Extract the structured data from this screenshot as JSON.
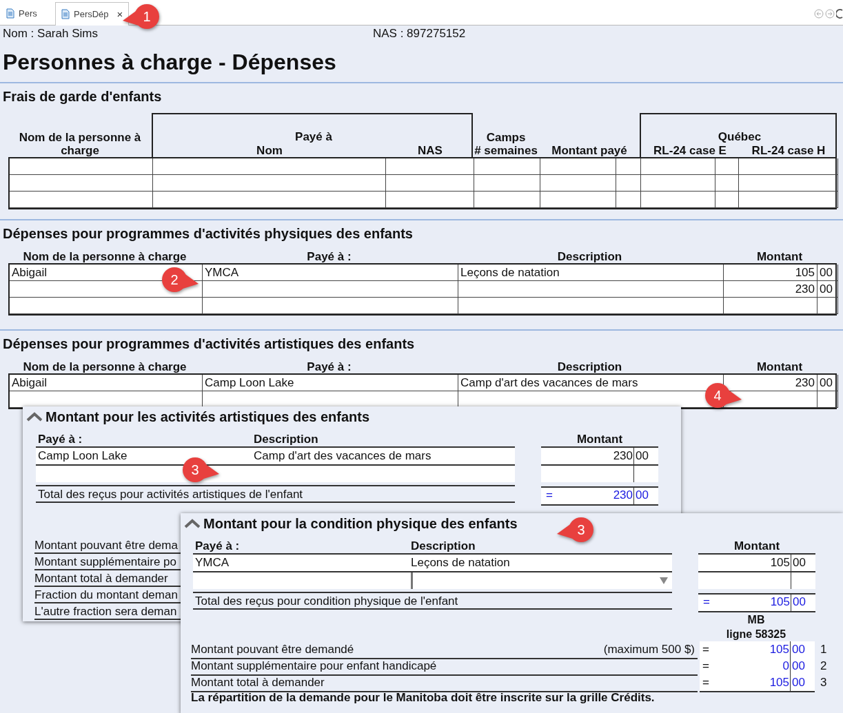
{
  "tabs": [
    {
      "label": "Pers",
      "selected": false
    },
    {
      "label": "PersDép",
      "selected": true,
      "close": "×"
    }
  ],
  "client": {
    "name": "Nom : Sarah Sims",
    "sin": "NAS : 897275152"
  },
  "title": "Personnes à charge - Dépenses",
  "childcare": {
    "heading": "Frais de garde d'enfants",
    "dependant": "Nom de la personne à charge",
    "paid_to": "Payé à",
    "paid_name": "Nom",
    "paid_sin": "NAS",
    "camps": [
      "Camps",
      "# semaines"
    ],
    "amount": "Montant payé",
    "quebec": "Québec",
    "rl24_e": "RL-24 case E",
    "rl24_h": "RL-24 case H"
  },
  "physical": {
    "heading": "Dépenses pour programmes d'activités physiques des enfants",
    "columns": [
      "Nom de la personne à charge",
      "Payé à :",
      "Description",
      "Montant"
    ],
    "rows": [
      {
        "name": "Abigail",
        "paid_to": "YMCA",
        "description": "Leçons de natation",
        "amount": "105",
        "cents": "00"
      },
      {
        "amount": "230",
        "cents": "00"
      },
      {}
    ]
  },
  "artistic": {
    "heading": "Dépenses pour programmes d'activités artistiques des enfants",
    "columns": [
      "Nom de la personne à charge",
      "Payé à :",
      "Description",
      "Montant"
    ],
    "rows": [
      {
        "name": "Abigail",
        "paid_to": "Camp Loon Lake",
        "description": "Camp d'art des vacances de mars",
        "amount": "230",
        "cents": "00"
      },
      {}
    ]
  },
  "artistic_panel": {
    "heading": "Montant pour les activités artistiques des enfants",
    "columns": [
      "Payé à :",
      "Description",
      "Montant"
    ],
    "rows": [
      {
        "kind": "text",
        "paid_to": "Camp Loon Lake",
        "description": "Camp d'art des vacances de mars",
        "amount": "230",
        "cents": "00"
      },
      {
        "kind": "text"
      }
    ],
    "total": {
      "label": "Total des reçus pour activités artistiques de l'enfant",
      "sign": "=",
      "amount": "230",
      "cents": "00"
    },
    "lines": [
      {
        "label": "Montant pouvant être dema"
      },
      {
        "label": "Montant supplémentaire po"
      },
      {
        "label": "Montant total à demander"
      },
      {
        "label": "Fraction du montant deman"
      },
      {
        "label": "L'autre fraction sera deman"
      }
    ]
  },
  "fitness_panel": {
    "heading": "Montant pour la condition physique des enfants",
    "columns": [
      "Payé à :",
      "Description",
      "Montant"
    ],
    "rows": [
      {
        "kind": "text",
        "paid_to": "YMCA",
        "description": "Leçons de natation",
        "amount": "105",
        "cents": "00"
      },
      {
        "kind": "dropdown"
      }
    ],
    "total": {
      "label": "Total des reçus pour condition physique de l'enfant",
      "sign": "=",
      "amount": "105",
      "cents": "00"
    },
    "province": "MB",
    "line_ref": "ligne 58325",
    "lines": [
      {
        "label": "Montant pouvant être demandé",
        "note": "(maximum 500 $)",
        "sign": "=",
        "amount": "105",
        "cents": "00",
        "number": "1"
      },
      {
        "label": "Montant supplémentaire pour enfant handicapé",
        "sign": "=",
        "amount": "0",
        "cents": "00",
        "number": "2"
      },
      {
        "label": "Montant total à demander",
        "sign": "=",
        "amount": "105",
        "cents": "00",
        "number": "3"
      }
    ],
    "footer": "La répartition de la demande pour le Manitoba doit être inscrite sur la grille Crédits."
  },
  "callouts": [
    {
      "number": "1",
      "kind": "left"
    },
    {
      "number": "2",
      "kind": "right"
    },
    {
      "number": "3",
      "kind": "right"
    },
    {
      "number": "3",
      "kind": "left"
    },
    {
      "number": "4",
      "kind": "right"
    }
  ]
}
